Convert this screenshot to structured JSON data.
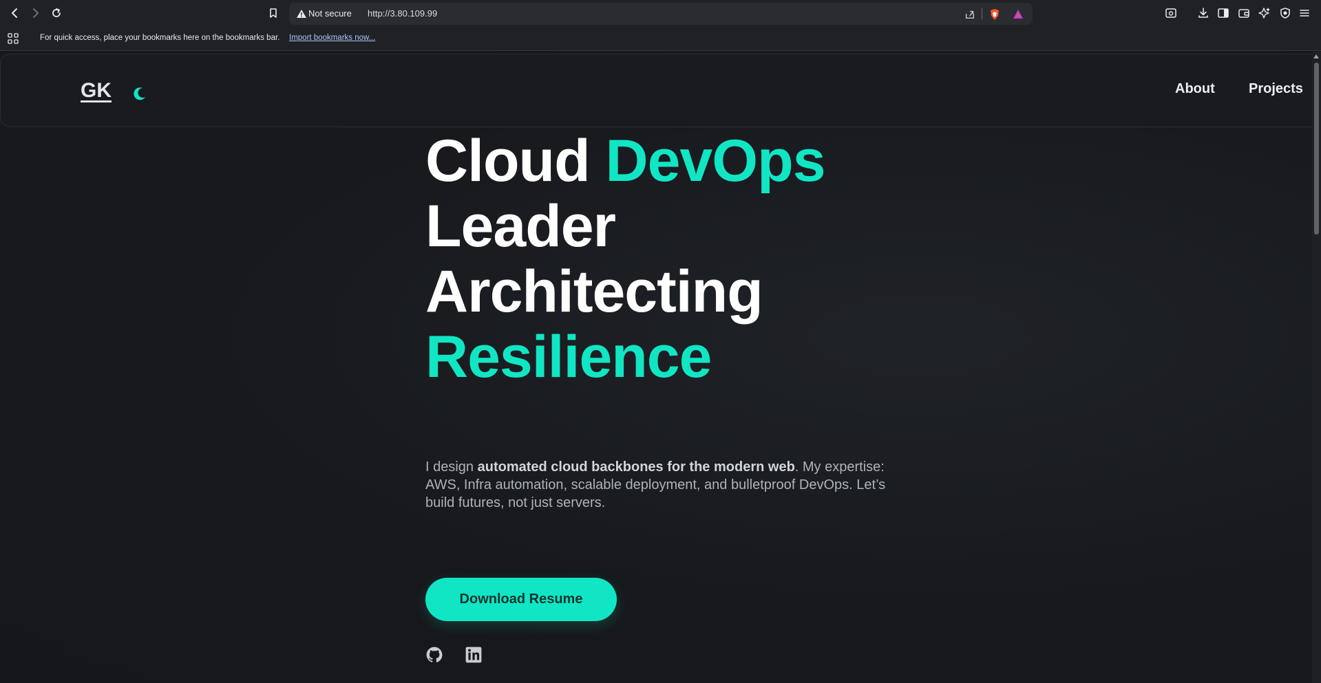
{
  "browser": {
    "security_label": "Not secure",
    "url": "http://3.80.109.99",
    "bookmarks_message": "For quick access, place your bookmarks here on the bookmarks bar.",
    "import_link": "Import bookmarks now..."
  },
  "site": {
    "logo": "GK",
    "nav": [
      "About",
      "Projects"
    ]
  },
  "hero": {
    "line1_white": "Cloud ",
    "line1_accent": "DevOps",
    "line2": "Leader",
    "line3": "Architecting",
    "line4_accent": "Resilience",
    "desc_pre": "I design ",
    "desc_bold": "automated cloud backbones for the modern web",
    "desc_post": ". My expertise: AWS, Infra automation, scalable deployment, and bulletproof DevOps. Let’s build futures, not just servers.",
    "cta_label": "Download Resume"
  },
  "colors": {
    "accent": "#10e6c4",
    "background": "#16181c",
    "text": "#ffffff"
  },
  "icons": [
    "back-icon",
    "forward-icon",
    "reload-icon",
    "bookmark-icon",
    "warning-icon",
    "share-icon",
    "brave-shield-icon",
    "brave-rewards-icon",
    "reader-mode-icon",
    "download-icon",
    "sidebar-icon",
    "wallet-icon",
    "leo-ai-icon",
    "vpn-icon",
    "menu-icon",
    "apps-icon",
    "moon-icon",
    "github-icon",
    "linkedin-icon"
  ]
}
